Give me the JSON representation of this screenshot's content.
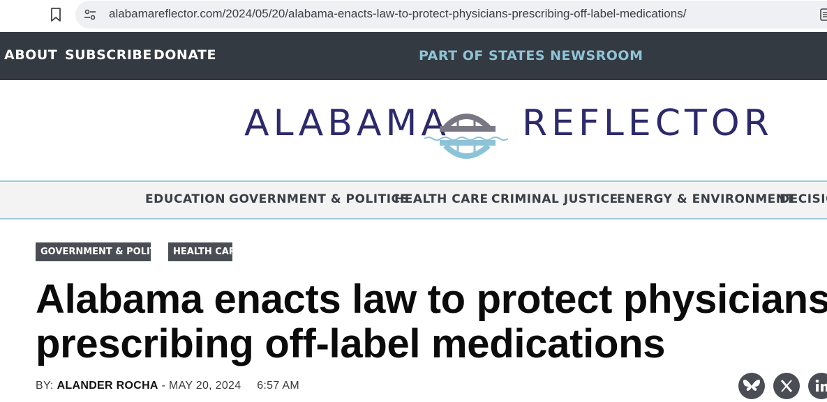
{
  "browser": {
    "url": "alabamareflector.com/2024/05/20/alabama-enacts-law-to-protect-physicians-prescribing-off-label-medications/"
  },
  "topnav": {
    "items": [
      "ABOUT",
      "SUBSCRIBE",
      "DONATE"
    ],
    "network_link": "PART OF STATES NEWSROOM"
  },
  "logo": {
    "left_word": "ALABAMA",
    "right_word": "REFLECTOR",
    "colors": {
      "wordmark": "#2c2a6b",
      "bridge": "#7a7785",
      "water": "#8cc3d8"
    }
  },
  "section_nav": {
    "items": [
      "EDUCATION",
      "GOVERNMENT & POLITICS",
      "HEALTH CARE",
      "CRIMINAL JUSTICE",
      "ENERGY & ENVIRONMENT",
      "DECISION"
    ]
  },
  "article": {
    "tags": [
      "GOVERNMENT & POLITICS",
      "HEALTH CARE"
    ],
    "headline_lines": [
      "Alabama enacts law to protect physicians",
      "prescribing off-label medications"
    ],
    "byline": {
      "prefix": "BY:",
      "author": "ALANDER ROCHA",
      "separator": "-",
      "date": "MAY 20, 2024",
      "time": "6:57 AM"
    },
    "share_icons": [
      "bluesky-icon",
      "x-icon",
      "linkedin-icon"
    ]
  },
  "colors": {
    "topnav_bg": "#333a42",
    "accent_light_blue": "#8fc3d6",
    "tag_bg": "#4a4e54",
    "secnav_bg": "#f3f3f3"
  }
}
